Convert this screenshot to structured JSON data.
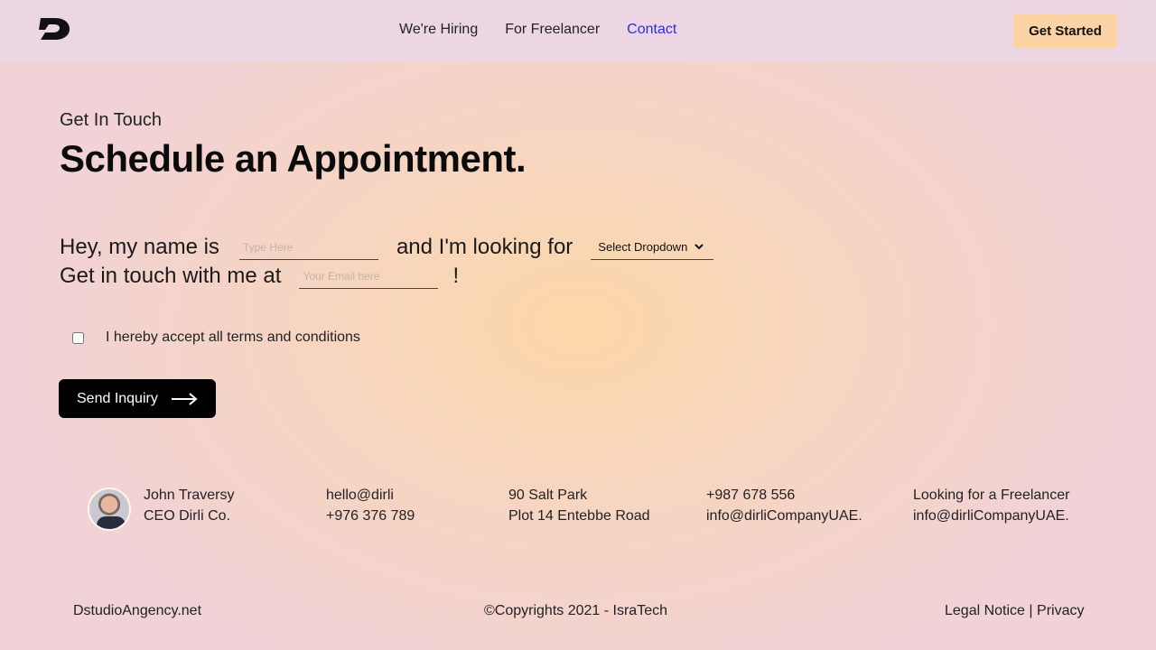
{
  "nav": {
    "links": [
      "We're Hiring",
      "For Freelancer",
      "Contact"
    ],
    "active": "Contact",
    "cta_label": "Get Started"
  },
  "hero": {
    "eyebrow": "Get In Touch",
    "title": "Schedule an Appointment."
  },
  "form": {
    "line1_prefix": "Hey, my name is",
    "name_placeholder": "Type Here",
    "line1_middle": "and I'm looking for",
    "dropdown_selected": "Select Dropdown",
    "line2_prefix": "Get in touch with me at",
    "email_placeholder": "Your Email here",
    "line2_suffix": "!",
    "terms_label": "I hereby accept all terms and conditions",
    "submit_label": "Send Inquiry"
  },
  "contacts": {
    "person_name": "John Traversy",
    "person_role": "CEO Dirli Co.",
    "col2_line1": "hello@dirli",
    "col2_line2": "+976 376 789",
    "col3_line1": "90 Salt Park",
    "col3_line2": "Plot 14 Entebbe Road",
    "col4_line1": "+987 678 556",
    "col4_line2": "info@dirliCompanyUAE.",
    "col5_line1": "Looking for a Freelancer",
    "col5_line2": "info@dirliCompanyUAE."
  },
  "footer": {
    "site": "DstudioAngency.net",
    "copyright": "©Copyrights 2021 - IsraTech",
    "legal": "Legal Notice",
    "separator": "|",
    "privacy": "Privacy"
  },
  "colors": {
    "accent": "#2d2fd6",
    "cta_bg": "#fbd3a4",
    "submit_bg": "#000000"
  },
  "icons": [
    "logo-d-icon",
    "chevron-down-icon",
    "arrow-right-icon"
  ]
}
